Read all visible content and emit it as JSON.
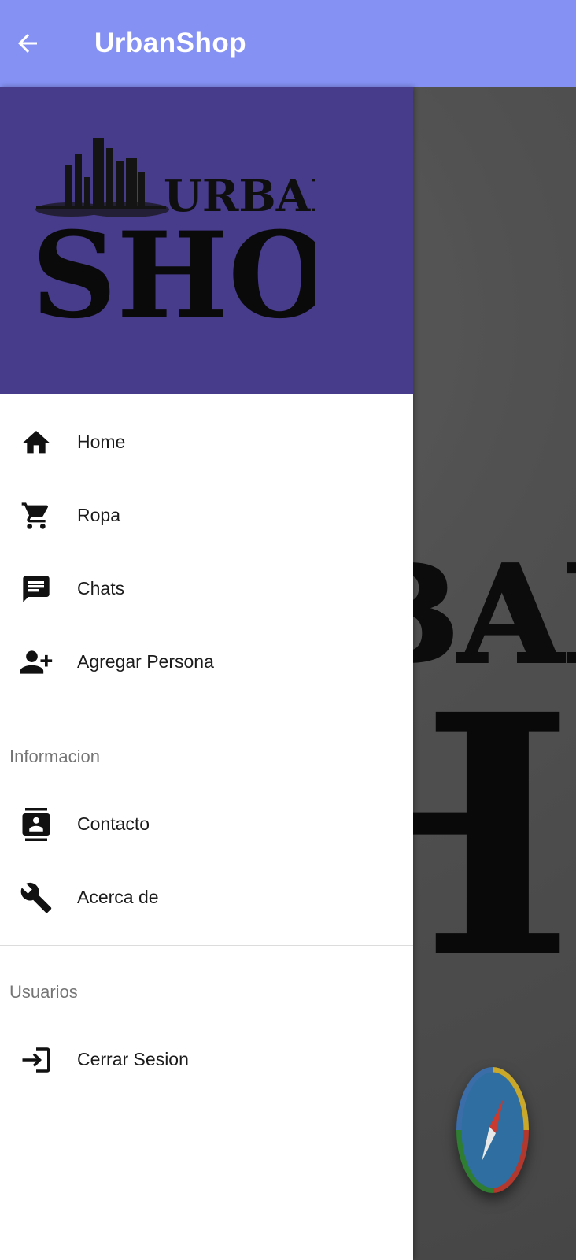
{
  "appbar": {
    "title": "UrbanShop",
    "background_color": "#8592f4",
    "back_icon": "arrow-back-icon"
  },
  "drawer": {
    "header_color": "#473b8b",
    "logo": {
      "line1": "URBAN",
      "line2": "SHOP"
    },
    "main_items": [
      {
        "label": "Home",
        "icon": "home-icon"
      },
      {
        "label": "Ropa",
        "icon": "shopping-cart-icon"
      },
      {
        "label": "Chats",
        "icon": "chat-icon"
      },
      {
        "label": "Agregar Persona",
        "icon": "person-add-icon"
      }
    ],
    "section_informacion": {
      "title": "Informacion",
      "items": [
        {
          "label": "Contacto",
          "icon": "contacts-icon"
        },
        {
          "label": "Acerca de",
          "icon": "wrench-icon"
        }
      ]
    },
    "section_usuarios": {
      "title": "Usuarios",
      "items": [
        {
          "label": "Cerrar Sesion",
          "icon": "login-icon"
        }
      ]
    }
  },
  "background": {
    "logo": {
      "line1": "URBAN",
      "line2": "SHOP"
    }
  },
  "fab": {
    "icon": "compass-icon"
  }
}
